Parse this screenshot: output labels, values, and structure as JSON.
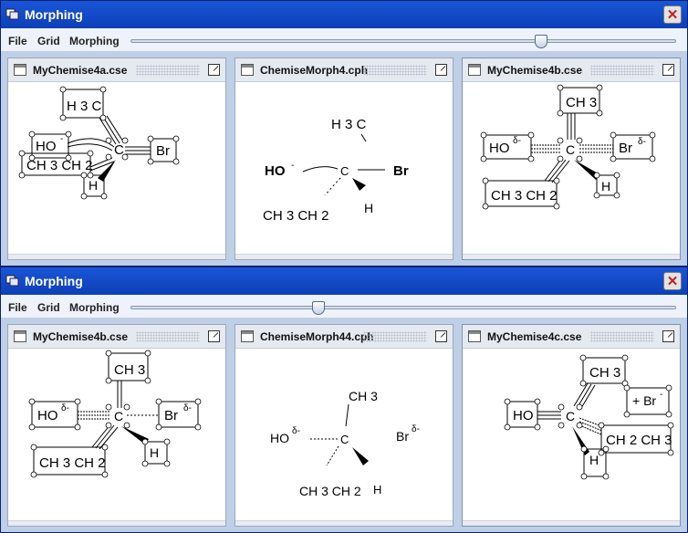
{
  "windows": [
    {
      "title": "Morphing",
      "menu": [
        "File",
        "Grid",
        "Morphing"
      ],
      "slider_value": 0.76,
      "panes": [
        {
          "title": "MyChemise4a.cse",
          "labels": {
            "ch3": "H 3 C",
            "oh": "HO",
            "oh_charge": "-",
            "c": "C",
            "br": "Br",
            "br_charge": "",
            "ethyl": "CH 3 CH 2",
            "h": "H"
          }
        },
        {
          "title": "ChemiseMorph4.cph",
          "labels": {
            "ch3": "H 3 C",
            "oh": "HO",
            "oh_charge": "-",
            "c": "C",
            "br": "Br",
            "br_charge": "",
            "ethyl": "CH 3 CH 2",
            "h": "H"
          }
        },
        {
          "title": "MyChemise4b.cse",
          "labels": {
            "ch3": "CH 3",
            "oh": "HO",
            "oh_charge": "δ-",
            "c": "C",
            "br": "Br",
            "br_charge": "δ-",
            "ethyl": "CH 3 CH 2",
            "h": "H"
          }
        }
      ]
    },
    {
      "title": "Morphing",
      "menu": [
        "File",
        "Grid",
        "Morphing"
      ],
      "slider_value": 0.34,
      "panes": [
        {
          "title": "MyChemise4b.cse",
          "labels": {
            "ch3": "CH 3",
            "oh": "HO",
            "oh_charge": "δ-",
            "c": "C",
            "br": "Br",
            "br_charge": "δ-",
            "ethyl": "CH 3 CH 2",
            "h": "H"
          }
        },
        {
          "title": "ChemiseMorph44.cph",
          "labels": {
            "ch3": "CH 3",
            "oh": "HO",
            "oh_charge": "δ-",
            "c": "C",
            "br": "Br",
            "br_charge": "δ-",
            "ethyl": "CH 3 CH 2",
            "h": "H"
          }
        },
        {
          "title": "MyChemise4c.cse",
          "labels": {
            "ch3": "CH 3",
            "oh": "HO",
            "oh_charge": "",
            "c": "C",
            "br": "+ Br",
            "br_charge": "-",
            "ethyl": "CH 2 CH 3",
            "h": "H"
          }
        }
      ]
    }
  ]
}
